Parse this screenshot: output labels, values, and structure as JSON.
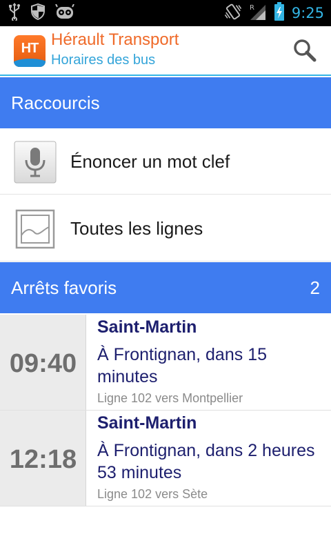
{
  "status_bar": {
    "time": "9:25",
    "icons": [
      "usb-icon",
      "shield-icon",
      "android-debug-icon",
      "vibrate-icon",
      "signal-roaming-icon",
      "battery-charging-icon"
    ],
    "roaming_letter": "R"
  },
  "action_bar": {
    "logo_text": "HT",
    "title": "Hérault Transport",
    "subtitle": "Horaires des bus",
    "title_color": "#ef6a29",
    "subtitle_color": "#33a4d9"
  },
  "shortcuts": {
    "header": "Raccourcis",
    "items": [
      {
        "label": "Énoncer un mot clef",
        "icon": "microphone-icon"
      },
      {
        "label": "Toutes les lignes",
        "icon": "picture-icon"
      }
    ]
  },
  "favorites": {
    "header": "Arrêts favoris",
    "count": "2",
    "items": [
      {
        "time": "09:40",
        "stop": "Saint-Martin",
        "direction": "À Frontignan, dans 15 minutes",
        "line": "Ligne 102 vers Montpellier"
      },
      {
        "time": "12:18",
        "stop": "Saint-Martin",
        "direction": "À Frontignan, dans 2 heures 53 minutes",
        "line": "Ligne 102 vers Sète"
      }
    ]
  },
  "colors": {
    "accent": "#33b5e5",
    "section_header": "#3f7cf0",
    "stop_text": "#1d1f6e"
  }
}
